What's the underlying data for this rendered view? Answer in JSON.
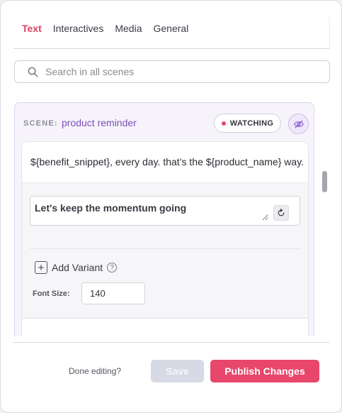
{
  "tabs": [
    {
      "label": "Text",
      "active": true
    },
    {
      "label": "Interactives",
      "active": false
    },
    {
      "label": "Media",
      "active": false
    },
    {
      "label": "General",
      "active": false
    }
  ],
  "search": {
    "placeholder": "Search in all scenes",
    "icon": "search-icon"
  },
  "scene": {
    "label": "SCENE:",
    "name": "product reminder",
    "watching_label": "WATCHING",
    "watching_dot_color": "#e8496a",
    "visibility_icon": "eye-off-icon",
    "line_text": "${benefit_snippet}, every day. that’s the ${product_name} way.",
    "variant_text": "Let's keep the momentum going",
    "regenerate_icon": "refresh-icon",
    "add_variant_label": "Add Variant",
    "font_size_label": "Font Size:",
    "font_size_value": "140"
  },
  "footer": {
    "done_label": "Done editing?",
    "save_label": "Save",
    "publish_label": "Publish Changes"
  },
  "colors": {
    "accent": "#e8466a",
    "active_tab": "#d9415f",
    "scene_name": "#7a4fb8",
    "save_disabled": "#d7d9e4"
  }
}
